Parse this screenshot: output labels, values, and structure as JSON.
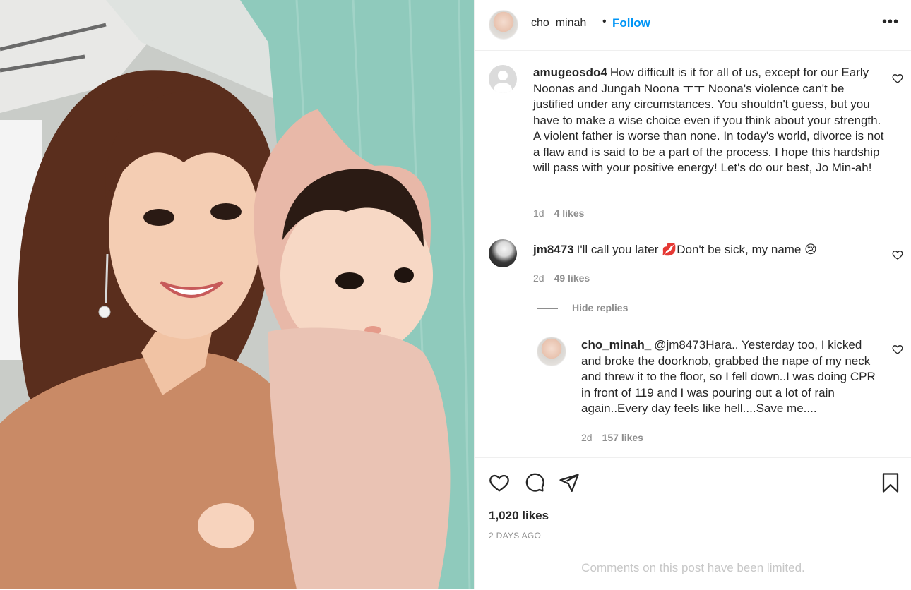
{
  "post": {
    "author": "cho_minah_",
    "separator": "•",
    "follow_label": "Follow",
    "more_label": "•••"
  },
  "comments": [
    {
      "username": "amugeosdo4",
      "text": "How difficult is it for all of us, except for our Early Noonas and Jungah Noona ㅜㅜ Noona's violence can't be justified under any circumstances. You shouldn't guess, but you have to make a wise choice even if you think about your strength. A violent father is worse than none. In today's world, divorce is not a flaw and is said to be a part of the process. I hope this hardship will pass with your positive energy! Let's do our best, Jo Min-ah!",
      "age": "1d",
      "likes": "4 likes"
    },
    {
      "username": "jm8473",
      "text": "I'll call you later 💋Don't be sick, my name 😢",
      "age": "2d",
      "likes": "49 likes"
    }
  ],
  "hide_replies_label": "Hide replies",
  "reply": {
    "username": "cho_minah_",
    "text": "@jm8473Hara.. Yesterday too, I kicked and broke the doorknob, grabbed the nape of my neck and threw it to the floor, so I fell down..I was doing CPR in front of 119 and I was pouring out a lot of rain again..Every day feels like hell....Save me....",
    "age": "2d",
    "likes": "157 likes"
  },
  "footer": {
    "likes_count": "1,020 likes",
    "posted": "2 DAYS AGO",
    "comments_limited": "Comments on this post have been limited."
  },
  "icons": {
    "like": "heart-icon",
    "comment": "comment-bubble-icon",
    "share": "paper-plane-icon",
    "save": "bookmark-icon"
  },
  "colors": {
    "accent": "#0095f6",
    "text": "#262626",
    "muted": "#8e8e8e",
    "divider": "#efefef"
  }
}
